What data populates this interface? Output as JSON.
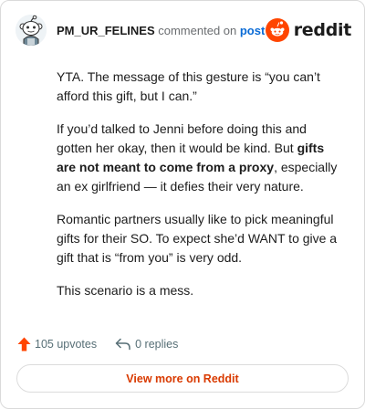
{
  "header": {
    "username": "PM_UR_FELINES",
    "action_text": " commented on ",
    "link_text": "post",
    "brand": "reddit"
  },
  "comment": {
    "paragraphs": [
      {
        "parts": [
          {
            "text": "YTA. The message of this gesture is “you can’t afford this gift, but I can.”",
            "bold": false
          }
        ]
      },
      {
        "parts": [
          {
            "text": "If you’d talked to Jenni before doing this and gotten her okay, then it would be kind. But ",
            "bold": false
          },
          {
            "text": "gifts are not meant to come from a proxy",
            "bold": true
          },
          {
            "text": ", especially an ex girlfriend — it defies their very nature.",
            "bold": false
          }
        ]
      },
      {
        "parts": [
          {
            "text": "Romantic partners usually like to pick meaningful gifts for their SO. To expect she’d WANT to give a gift that is “from you” is very odd.",
            "bold": false
          }
        ]
      },
      {
        "parts": [
          {
            "text": "This scenario is a mess.",
            "bold": false
          }
        ]
      }
    ]
  },
  "stats": {
    "upvotes": "105 upvotes",
    "replies": "0 replies"
  },
  "view_more_label": "View more on Reddit",
  "colors": {
    "accent": "#ff4500",
    "link": "#0a6bd6",
    "muted": "#576f76",
    "button_text": "#d93a00"
  },
  "icons": [
    "avatar-snoo-icon",
    "reddit-logo-icon",
    "upvote-arrow-icon",
    "reply-arrow-icon"
  ]
}
